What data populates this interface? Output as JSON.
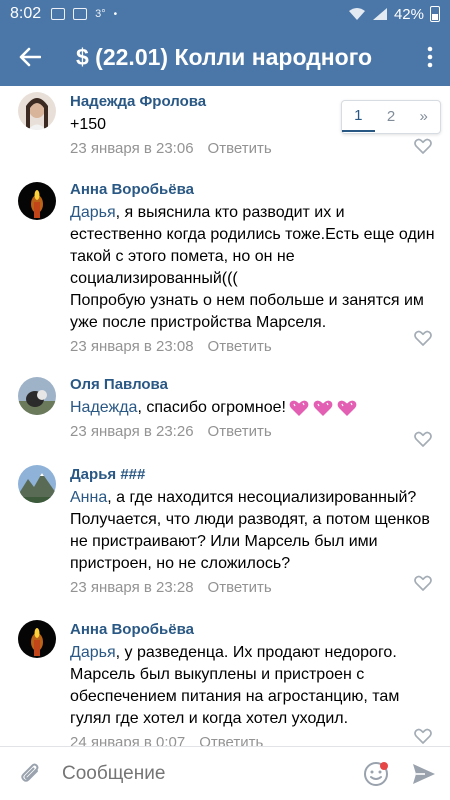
{
  "status_bar": {
    "time": "8:02",
    "small_label": "3°",
    "battery": "42%"
  },
  "header": {
    "title": "$ (22.01) Колли народного"
  },
  "pager": {
    "pages": [
      "1",
      "2"
    ],
    "next": "»"
  },
  "comments": [
    {
      "author": "Надежда Фролова",
      "mention": "",
      "text": "+150",
      "time": "23 января в 23:06",
      "reply": "Ответить"
    },
    {
      "author": "Анна Воробьёва",
      "mention": "Дарья",
      "text": ", я выяснила кто разводит их и естественно когда родились тоже.Есть еще один такой с этого помета, но он не социализированный(((\nПопробую узнать о нем побольше и занятся им уже после пристройства Марселя.",
      "time": "23 января в 23:08",
      "reply": "Ответить"
    },
    {
      "author": "Оля Павлова",
      "mention": "Надежда",
      "text": ", спасибо огромное!",
      "time": "23 января в 23:26",
      "reply": "Ответить"
    },
    {
      "author": "Дарья ###",
      "mention": "Анна",
      "text": ", а где находится несоциализированный? Получается, что люди разводят, а потом щенков не пристраивают? Или Марсель был ими пристроен, но не сложилось?",
      "time": "23 января в 23:28",
      "reply": "Ответить"
    },
    {
      "author": "Анна Воробьёва",
      "mention": "Дарья",
      "text": ", у разведенца. Их продают недорого. Марсель был выкуплены и пристроен  с обеспечением питания на агростанцию, там гулял где хотел и когда хотел уходил.",
      "time": "24 января в 0:07",
      "reply": "Ответить"
    }
  ],
  "composer": {
    "placeholder": "Сообщение"
  },
  "colors": {
    "header_bg": "#4a76a8",
    "link": "#2a5885",
    "meta": "#939393"
  }
}
